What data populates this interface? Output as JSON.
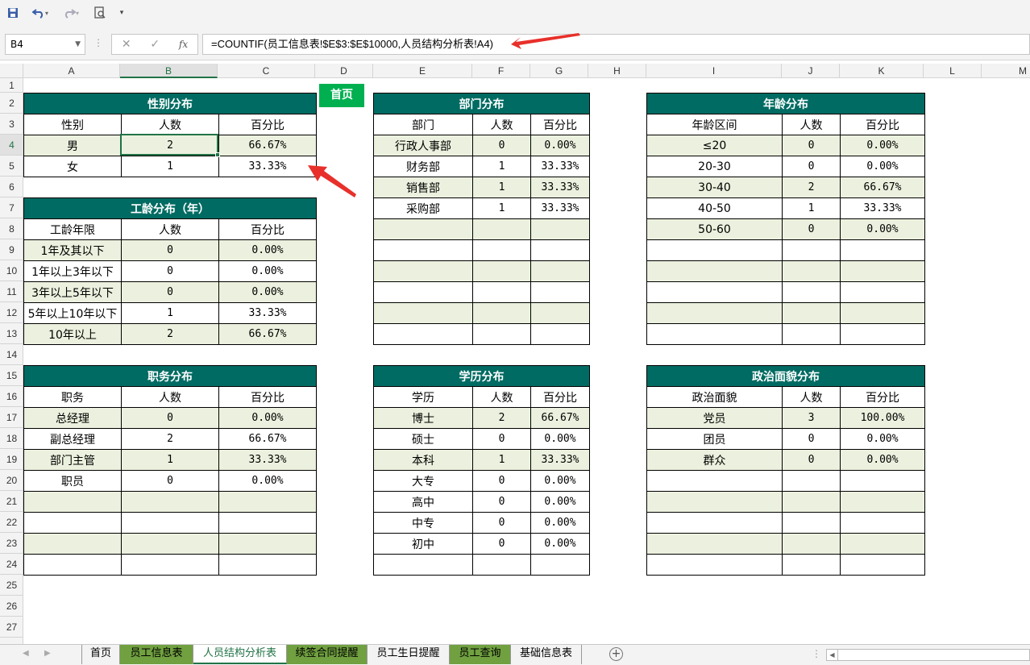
{
  "qat": {
    "save": "save-icon",
    "undo": "undo-icon",
    "redo": "redo-icon",
    "preview": "print-preview-icon",
    "more": "▾"
  },
  "namebox": "B4",
  "formula": "=COUNTIF(员工信息表!$E$3:$E$10000,人员结构分析表!A4)",
  "fxbtns": {
    "cancel": "✕",
    "confirm": "✓",
    "fx": "fx"
  },
  "columns": [
    "A",
    "B",
    "C",
    "D",
    "E",
    "F",
    "G",
    "H",
    "I",
    "J",
    "K",
    "L",
    "M"
  ],
  "rows": [
    "1",
    "2",
    "3",
    "4",
    "5",
    "6",
    "7",
    "8",
    "9",
    "10",
    "11",
    "12",
    "13",
    "14",
    "15",
    "16",
    "17",
    "18",
    "19",
    "20",
    "21",
    "22",
    "23",
    "24",
    "25",
    "26",
    "27"
  ],
  "home_button": "首页",
  "tables": {
    "gender": {
      "title": "性别分布",
      "headers": [
        "性别",
        "人数",
        "百分比"
      ],
      "rows": [
        [
          "男",
          "2",
          "66.67%"
        ],
        [
          "女",
          "1",
          "33.33%"
        ]
      ]
    },
    "seniority": {
      "title": "工龄分布（年）",
      "headers": [
        "工龄年限",
        "人数",
        "百分比"
      ],
      "rows": [
        [
          "1年及其以下",
          "0",
          "0.00%"
        ],
        [
          "1年以上3年以下",
          "0",
          "0.00%"
        ],
        [
          "3年以上5年以下",
          "0",
          "0.00%"
        ],
        [
          "5年以上10年以下",
          "1",
          "33.33%"
        ],
        [
          "10年以上",
          "2",
          "66.67%"
        ]
      ]
    },
    "position": {
      "title": "职务分布",
      "headers": [
        "职务",
        "人数",
        "百分比"
      ],
      "rows": [
        [
          "总经理",
          "0",
          "0.00%"
        ],
        [
          "副总经理",
          "2",
          "66.67%"
        ],
        [
          "部门主管",
          "1",
          "33.33%"
        ],
        [
          "职员",
          "0",
          "0.00%"
        ],
        [
          "",
          "",
          ""
        ],
        [
          "",
          "",
          ""
        ],
        [
          "",
          "",
          ""
        ],
        [
          "",
          "",
          ""
        ]
      ]
    },
    "department": {
      "title": "部门分布",
      "headers": [
        "部门",
        "人数",
        "百分比"
      ],
      "rows": [
        [
          "行政人事部",
          "0",
          "0.00%"
        ],
        [
          "财务部",
          "1",
          "33.33%"
        ],
        [
          "销售部",
          "1",
          "33.33%"
        ],
        [
          "采购部",
          "1",
          "33.33%"
        ],
        [
          "",
          "",
          ""
        ],
        [
          "",
          "",
          ""
        ],
        [
          "",
          "",
          ""
        ],
        [
          "",
          "",
          ""
        ],
        [
          "",
          "",
          ""
        ],
        [
          "",
          "",
          ""
        ]
      ]
    },
    "education": {
      "title": "学历分布",
      "headers": [
        "学历",
        "人数",
        "百分比"
      ],
      "rows": [
        [
          "博士",
          "2",
          "66.67%"
        ],
        [
          "硕士",
          "0",
          "0.00%"
        ],
        [
          "本科",
          "1",
          "33.33%"
        ],
        [
          "大专",
          "0",
          "0.00%"
        ],
        [
          "高中",
          "0",
          "0.00%"
        ],
        [
          "中专",
          "0",
          "0.00%"
        ],
        [
          "初中",
          "0",
          "0.00%"
        ],
        [
          "",
          "",
          ""
        ]
      ]
    },
    "age": {
      "title": "年龄分布",
      "headers": [
        "年龄区间",
        "人数",
        "百分比"
      ],
      "rows": [
        [
          "≤20",
          "0",
          "0.00%"
        ],
        [
          "20-30",
          "0",
          "0.00%"
        ],
        [
          "30-40",
          "2",
          "66.67%"
        ],
        [
          "40-50",
          "1",
          "33.33%"
        ],
        [
          "50-60",
          "0",
          "0.00%"
        ],
        [
          "",
          "",
          ""
        ],
        [
          "",
          "",
          ""
        ],
        [
          "",
          "",
          ""
        ],
        [
          "",
          "",
          ""
        ],
        [
          "",
          "",
          ""
        ]
      ]
    },
    "political": {
      "title": "政治面貌分布",
      "headers": [
        "政治面貌",
        "人数",
        "百分比"
      ],
      "rows": [
        [
          "党员",
          "3",
          "100.00%"
        ],
        [
          "团员",
          "0",
          "0.00%"
        ],
        [
          "群众",
          "0",
          "0.00%"
        ],
        [
          "",
          "",
          ""
        ],
        [
          "",
          "",
          ""
        ],
        [
          "",
          "",
          ""
        ],
        [
          "",
          "",
          ""
        ],
        [
          "",
          "",
          ""
        ]
      ]
    }
  },
  "sheet_tabs": [
    "首页",
    "员工信息表",
    "人员结构分析表",
    "续签合同提醒",
    "员工生日提醒",
    "员工查询",
    "基础信息表"
  ],
  "active_tab": "人员结构分析表",
  "colors": {
    "header_bg": "#006b62",
    "alt_row": "#ebf1de",
    "home_btn": "#00b050",
    "tab_green": "#70a040",
    "arrow": "#e8302a"
  }
}
